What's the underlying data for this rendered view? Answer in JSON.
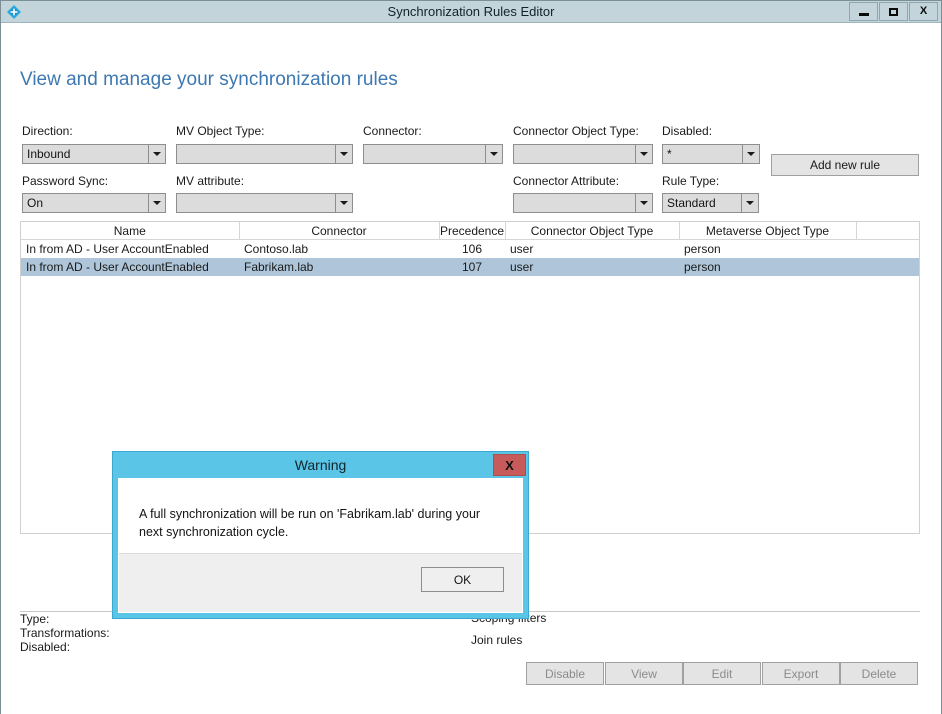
{
  "window": {
    "title": "Synchronization Rules Editor",
    "app_icon": "sync-rules-diamond-icon",
    "minimize_label": "",
    "maximize_label": "",
    "close_label": "X"
  },
  "page": {
    "heading": "View and manage your synchronization rules"
  },
  "filters": {
    "direction": {
      "label": "Direction:",
      "value": "Inbound"
    },
    "mv_object_type": {
      "label": "MV Object Type:",
      "value": ""
    },
    "connector": {
      "label": "Connector:",
      "value": ""
    },
    "connector_object_type": {
      "label": "Connector Object Type:",
      "value": ""
    },
    "disabled": {
      "label": "Disabled:",
      "value": "*"
    },
    "password_sync": {
      "label": "Password Sync:",
      "value": "On"
    },
    "mv_attribute": {
      "label": "MV attribute:",
      "value": ""
    },
    "connector_attribute": {
      "label": "Connector Attribute:",
      "value": ""
    },
    "rule_type": {
      "label": "Rule Type:",
      "value": "Standard"
    },
    "add_new_rule_label": "Add new rule"
  },
  "rules_table": {
    "columns": [
      "Name",
      "Connector",
      "Precedence",
      "Connector Object Type",
      "Metaverse Object Type",
      ""
    ],
    "rows": [
      {
        "name": "In from AD - User AccountEnabled",
        "connector": "Contoso.lab",
        "precedence": "106",
        "connector_object_type": "user",
        "metaverse_object_type": "person",
        "selected": false
      },
      {
        "name": "In from AD - User AccountEnabled",
        "connector": "Fabrikam.lab",
        "precedence": "107",
        "connector_object_type": "user",
        "metaverse_object_type": "person",
        "selected": true
      }
    ]
  },
  "details": {
    "type_label": "Type:",
    "transformations_label": "Transformations:",
    "disabled_label": "Disabled:",
    "scoping_filters_label": "Scoping filters",
    "join_rules_label": "Join rules"
  },
  "actions": {
    "disable": "Disable",
    "view": "View",
    "edit": "Edit",
    "export": "Export",
    "delete": "Delete"
  },
  "dialog": {
    "title": "Warning",
    "close_label": "X",
    "message": "A full synchronization will be run on 'Fabrikam.lab' during your next synchronization cycle.",
    "ok_label": "OK"
  },
  "colors": {
    "titlebar": "#c3d4da",
    "heading": "#3d78b2",
    "dialog_titlebar": "#5bc5e8",
    "dialog_close": "#c75b5b",
    "row_selected": "#afc6da"
  }
}
